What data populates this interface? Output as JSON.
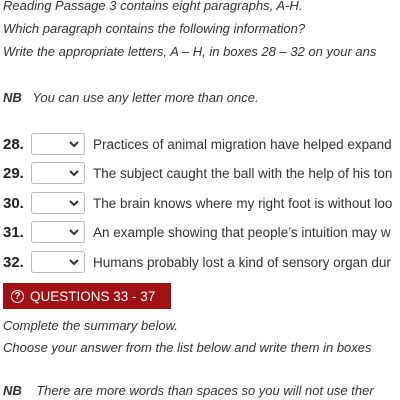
{
  "instructions": {
    "line1": "Reading Passage 3 contains eight paragraphs, A-H.",
    "line2": "Which paragraph contains the following information?",
    "line3": "Write the appropriate letters, A – H, in boxes 28 – 32 on your ans",
    "nb_label": "NB",
    "nb_text": "You can use any letter more than once."
  },
  "questions": [
    {
      "number": "28.",
      "text": "Practices of animal migration have helped expand",
      "selected": ""
    },
    {
      "number": "29.",
      "text": "The subject caught the ball with the help of his ton",
      "selected": ""
    },
    {
      "number": "30.",
      "text": "The brain knows where my right foot is without loo",
      "selected": ""
    },
    {
      "number": "31.",
      "text": "An example showing that people’s intuition may w",
      "selected": ""
    },
    {
      "number": "32.",
      "text": "Humans probably lost a kind of sensory organ dur",
      "selected": ""
    }
  ],
  "section": {
    "title": "QUESTIONS 33 - 37",
    "icon": "question-circle-icon",
    "color": "#a01014"
  },
  "summary": {
    "line1": "Complete the summary below.",
    "line2": "Choose your answer from the list below and write them in boxes",
    "nb_label": "NB",
    "nb_text": "There are more words than spaces so you will not use ther"
  }
}
